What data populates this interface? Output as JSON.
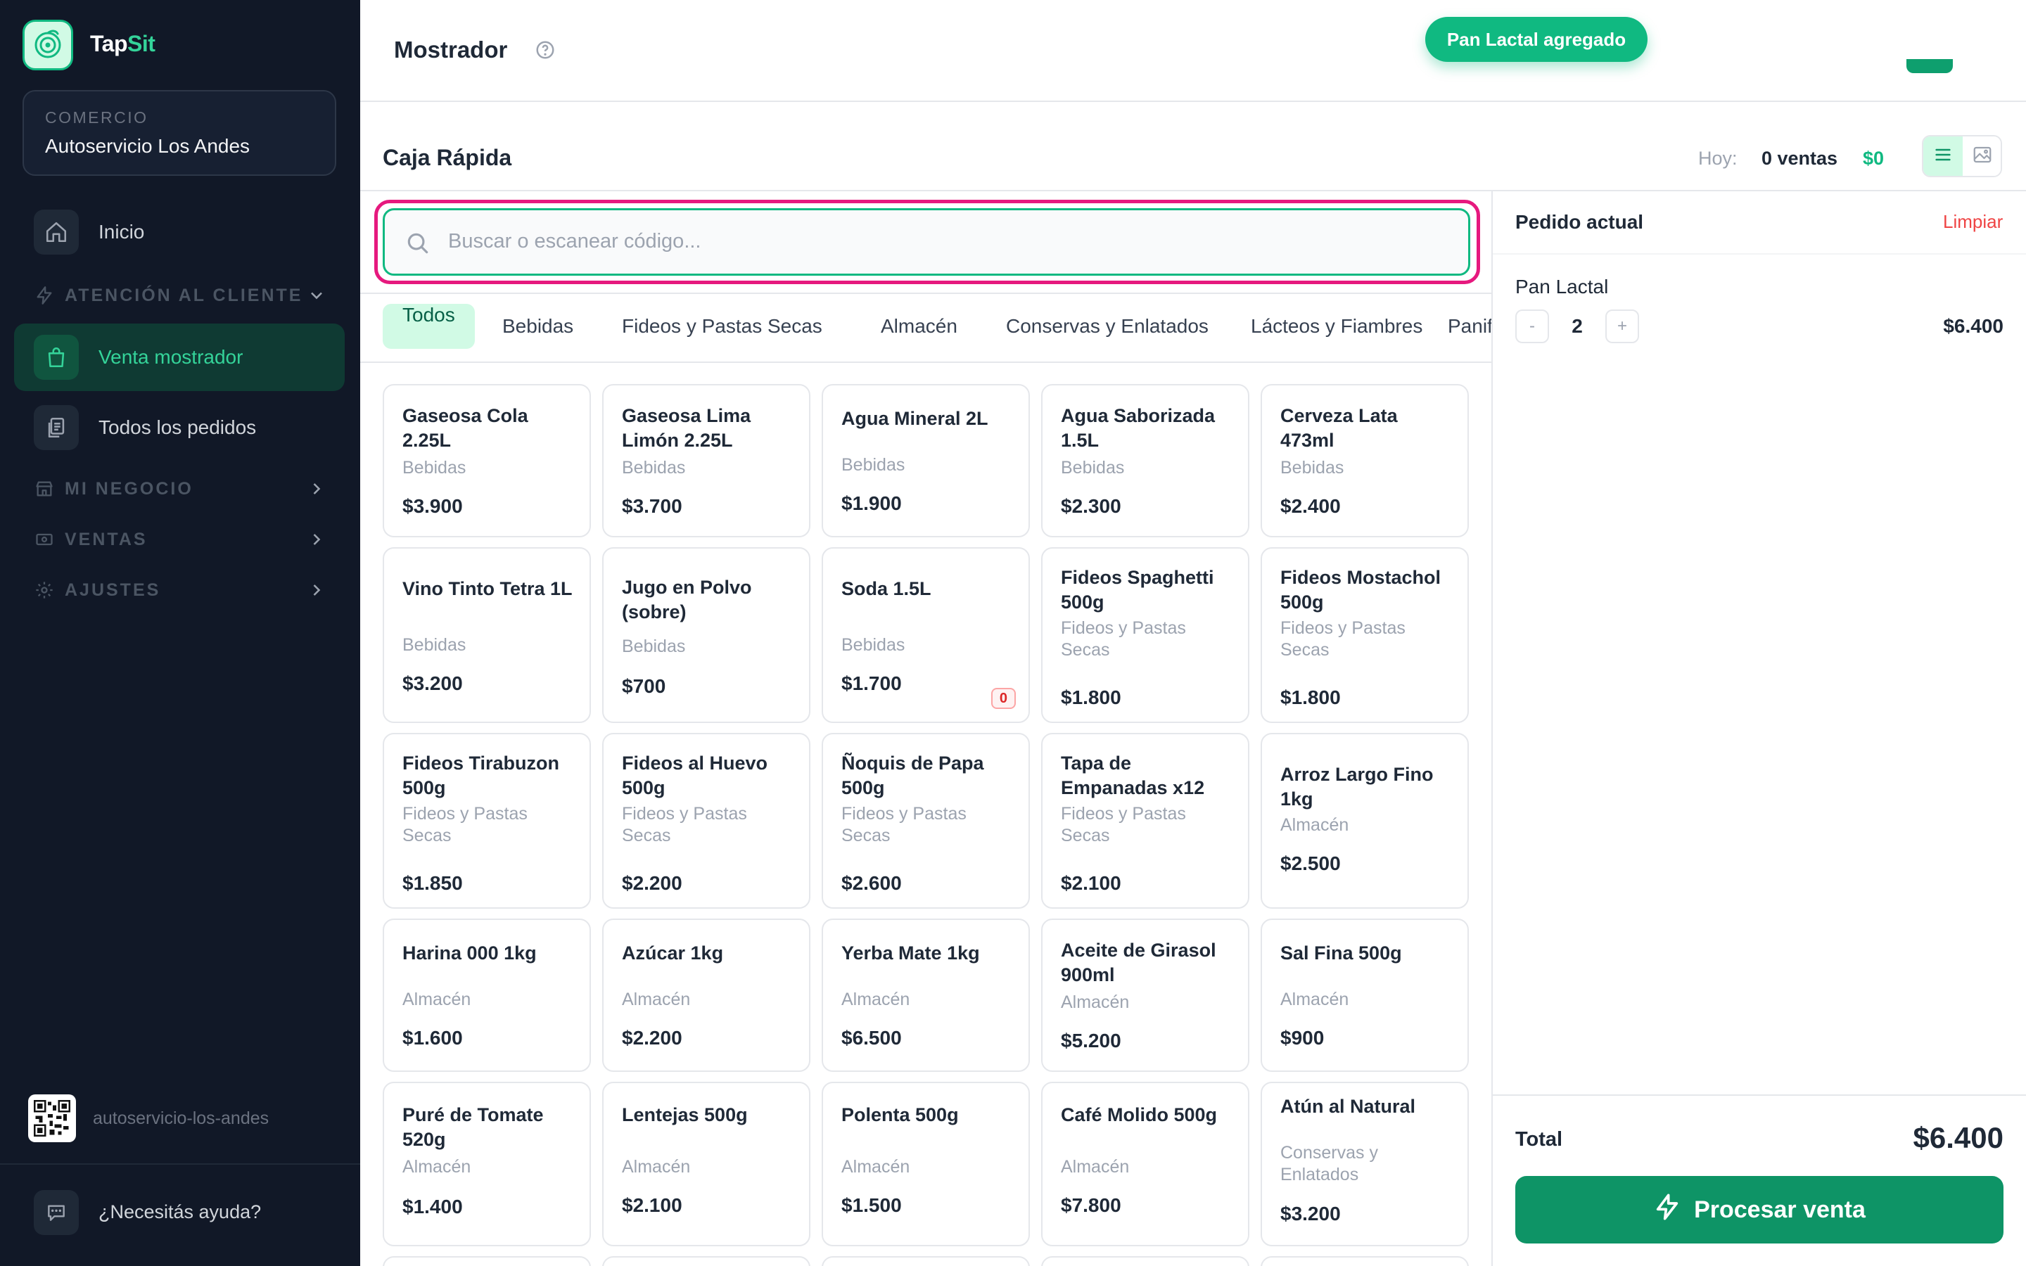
{
  "brand": {
    "name_part1": "Tap",
    "name_part2": "Sit",
    "logo_icon": "leaf-logo-icon",
    "accent_color": "#10b981"
  },
  "sidebar": {
    "store_label": "COMERCIO",
    "store_name": "Autoservicio Los Andes",
    "items": [
      {
        "label": "Inicio",
        "icon": "home-icon",
        "active": false
      },
      {
        "label": "Venta mostrador",
        "icon": "shopping-bag-icon",
        "active": true
      },
      {
        "label": "Todos los pedidos",
        "icon": "clipboard-icon",
        "active": false
      }
    ],
    "sections": [
      {
        "label": "ATENCIÓN AL CLIENTE",
        "icon": "lightning-icon",
        "expanded": true
      },
      {
        "label": "MI NEGOCIO",
        "icon": "store-icon",
        "expanded": false
      },
      {
        "label": "VENTAS",
        "icon": "cash-icon",
        "expanded": false
      },
      {
        "label": "AJUSTES",
        "icon": "gear-icon",
        "expanded": false
      }
    ],
    "slug": "autoservicio-los-andes",
    "help_label": "¿Necesitás ayuda?"
  },
  "header": {
    "title": "Mostrador",
    "toast": "Pan Lactal agregado"
  },
  "caja": {
    "title": "Caja Rápida",
    "today_label": "Hoy:",
    "today_sales": "0 ventas",
    "today_total": "$0",
    "view_mode": "list"
  },
  "search": {
    "placeholder": "Buscar o escanear código..."
  },
  "tabs": [
    {
      "label": "Todos",
      "active": true
    },
    {
      "label": "Bebidas",
      "active": false
    },
    {
      "label": "Fideos y Pastas Secas",
      "active": false
    },
    {
      "label": "Almacén",
      "active": false
    },
    {
      "label": "Conservas y Enlatados",
      "active": false
    },
    {
      "label": "Lácteos y Fiambres",
      "active": false
    },
    {
      "label": "Panificados",
      "active": false
    }
  ],
  "products": [
    {
      "name": "Gaseosa Cola 2.25L",
      "category": "Bebidas",
      "price": "$3.900"
    },
    {
      "name": "Gaseosa Lima Limón 2.25L",
      "category": "Bebidas",
      "price": "$3.700"
    },
    {
      "name": "Agua Mineral 2L",
      "category": "Bebidas",
      "price": "$1.900"
    },
    {
      "name": "Agua Saborizada 1.5L",
      "category": "Bebidas",
      "price": "$2.300"
    },
    {
      "name": "Cerveza Lata 473ml",
      "category": "Bebidas",
      "price": "$2.400"
    },
    {
      "name": "Vino Tinto Tetra 1L",
      "category": "Bebidas",
      "price": "$3.200"
    },
    {
      "name": "Jugo en Polvo (sobre)",
      "category": "Bebidas",
      "price": "$700"
    },
    {
      "name": "Soda 1.5L",
      "category": "Bebidas",
      "price": "$1.700",
      "stock": "0"
    },
    {
      "name": "Fideos Spaghetti 500g",
      "category": "Fideos y Pastas Secas",
      "price": "$1.800"
    },
    {
      "name": "Fideos Mostachol 500g",
      "category": "Fideos y Pastas Secas",
      "price": "$1.800"
    },
    {
      "name": "Fideos Tirabuzon 500g",
      "category": "Fideos y Pastas Secas",
      "price": "$1.850"
    },
    {
      "name": "Fideos al Huevo 500g",
      "category": "Fideos y Pastas Secas",
      "price": "$2.200"
    },
    {
      "name": "Ñoquis de Papa 500g",
      "category": "Fideos y Pastas Secas",
      "price": "$2.600"
    },
    {
      "name": "Tapa de Empanadas x12",
      "category": "Fideos y Pastas Secas",
      "price": "$2.100"
    },
    {
      "name": "Arroz Largo Fino 1kg",
      "category": "Almacén",
      "price": "$2.500"
    },
    {
      "name": "Harina 000 1kg",
      "category": "Almacén",
      "price": "$1.600"
    },
    {
      "name": "Azúcar 1kg",
      "category": "Almacén",
      "price": "$2.200"
    },
    {
      "name": "Yerba Mate 1kg",
      "category": "Almacén",
      "price": "$6.500"
    },
    {
      "name": "Aceite de Girasol 900ml",
      "category": "Almacén",
      "price": "$5.200"
    },
    {
      "name": "Sal Fina 500g",
      "category": "Almacén",
      "price": "$900"
    },
    {
      "name": "Puré de Tomate 520g",
      "category": "Almacén",
      "price": "$1.400"
    },
    {
      "name": "Lentejas 500g",
      "category": "Almacén",
      "price": "$2.100"
    },
    {
      "name": "Polenta 500g",
      "category": "Almacén",
      "price": "$1.500"
    },
    {
      "name": "Café Molido 500g",
      "category": "Almacén",
      "price": "$7.800"
    },
    {
      "name": "Atún al Natural",
      "category": "Conservas y Enlatados",
      "price": "$3.200"
    }
  ],
  "order": {
    "title": "Pedido actual",
    "clear_label": "Limpiar",
    "items": [
      {
        "name": "Pan Lactal",
        "minus": "-",
        "qty": "2",
        "plus": "+",
        "price": "$6.400"
      }
    ],
    "total_label": "Total",
    "total": "$6.400",
    "process_label": "Procesar venta"
  }
}
